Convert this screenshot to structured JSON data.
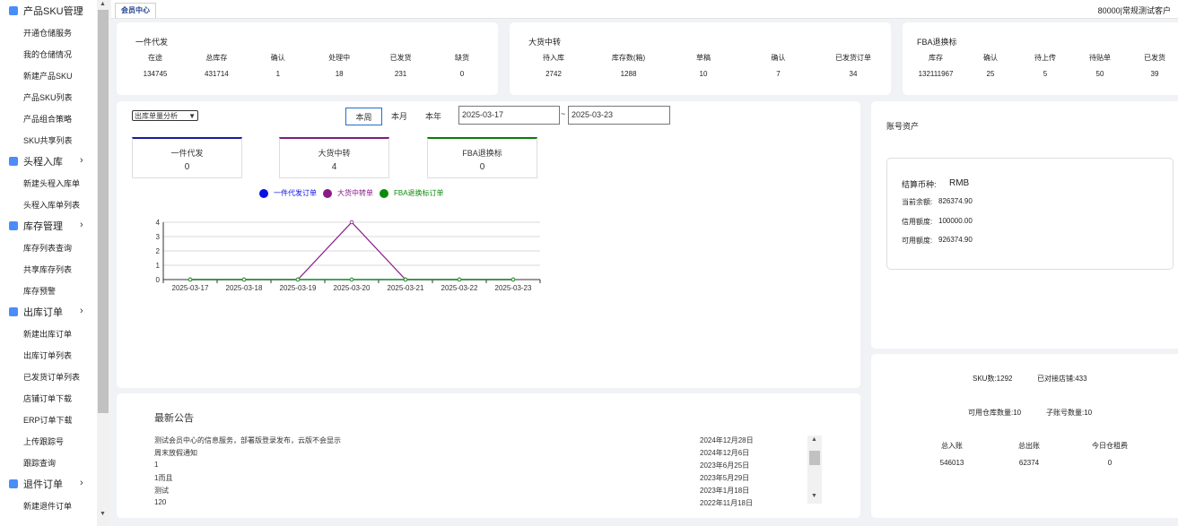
{
  "sidebar": {
    "groups": [
      {
        "label": "产品SKU管理",
        "icon": "grid-icon",
        "items": [
          "开通仓储服务",
          "我的仓储情况",
          "新建产品SKU",
          "产品SKU列表",
          "产品组合策略",
          "SKU共享列表"
        ]
      },
      {
        "label": "头程入库",
        "icon": "inbound-icon",
        "items": [
          "新建头程入库单",
          "头程入库单列表"
        ]
      },
      {
        "label": "库存管理",
        "icon": "warehouse-icon",
        "items": [
          "库存列表查询",
          "共享库存列表",
          "库存预警"
        ]
      },
      {
        "label": "出库订单",
        "icon": "outbound-icon",
        "items": [
          "新建出库订单",
          "出库订单列表",
          "已发货订单列表",
          "店铺订单下载",
          "ERP订单下载",
          "上传跟踪号",
          "跟踪查询"
        ]
      },
      {
        "label": "退件订单",
        "icon": "return-icon",
        "items": [
          "新建退件订单"
        ]
      }
    ]
  },
  "topbar": {
    "tab": "会员中心",
    "account": "80000|常规测试客户"
  },
  "cards": {
    "yijian": {
      "title": "一件代发",
      "stats": [
        {
          "label": "在途",
          "value": "134745"
        },
        {
          "label": "总库存",
          "value": "431714"
        },
        {
          "label": "确认",
          "value": "1"
        },
        {
          "label": "处理中",
          "value": "18"
        },
        {
          "label": "已发货",
          "value": "231"
        },
        {
          "label": "缺货",
          "value": "0"
        }
      ]
    },
    "dahuo": {
      "title": "大货中转",
      "stats": [
        {
          "label": "待入库",
          "value": "2742"
        },
        {
          "label": "库存数(箱)",
          "value": "1288"
        },
        {
          "label": "草稿",
          "value": "10"
        },
        {
          "label": "确认",
          "value": "7"
        },
        {
          "label": "已发货订单",
          "value": "34"
        }
      ]
    },
    "fba": {
      "title": "FBA退换标",
      "stats": [
        {
          "label": "库存",
          "value": "132111967"
        },
        {
          "label": "确认",
          "value": "25"
        },
        {
          "label": "待上传",
          "value": "5"
        },
        {
          "label": "待贴单",
          "value": "50"
        },
        {
          "label": "已发货",
          "value": "39"
        }
      ]
    }
  },
  "analysis": {
    "select": "出库单量分析",
    "periods": [
      "本周",
      "本月",
      "本年"
    ],
    "active_period": "本周",
    "date_from": "2025-03-17",
    "date_sep": "~",
    "date_to": "2025-03-23",
    "boxes": [
      {
        "label": "一件代发",
        "value": "0",
        "color": "#1a1aa0"
      },
      {
        "label": "大货中转",
        "value": "4",
        "color": "#7b1e7b"
      },
      {
        "label": "FBA退换标",
        "value": "0",
        "color": "#0a7a0a"
      }
    ]
  },
  "chart_data": {
    "type": "line",
    "x": [
      "2025-03-17",
      "2025-03-18",
      "2025-03-19",
      "2025-03-20",
      "2025-03-21",
      "2025-03-22",
      "2025-03-23"
    ],
    "ylim": [
      0,
      4
    ],
    "yticks": [
      "0",
      "1",
      "2",
      "3",
      "4"
    ],
    "series": [
      {
        "name": "一件代发订单",
        "color": "#0b10e6",
        "values": [
          0,
          0,
          0,
          0,
          0,
          0,
          0
        ]
      },
      {
        "name": "大货中转单",
        "color": "#8a1a8a",
        "values": [
          0,
          0,
          0,
          4,
          0,
          0,
          0
        ]
      },
      {
        "name": "FBA退换标订单",
        "color": "#0a8a0a",
        "values": [
          0,
          0,
          0,
          0,
          0,
          0,
          0
        ]
      }
    ]
  },
  "notices": {
    "title": "最新公告",
    "items": [
      {
        "text": "测试会员中心的信息服务，部署版登录发布，云版不会显示",
        "date": "2024年12月28日"
      },
      {
        "text": "周末放假通知",
        "date": "2024年12月6日"
      },
      {
        "text": "1",
        "date": "2023年6月25日"
      },
      {
        "text": "1而且",
        "date": "2023年5月29日"
      },
      {
        "text": "测试",
        "date": "2023年1月18日"
      },
      {
        "text": "120",
        "date": "2022年11月18日"
      }
    ]
  },
  "assets": {
    "title": "账号资产",
    "currency_label": "结算币种:",
    "currency": "RMB",
    "rows": [
      {
        "label": "当前余额:",
        "value": "826374.90"
      },
      {
        "label": "信用额度:",
        "value": "100000.00"
      },
      {
        "label": "可用额度:",
        "value": "926374.90"
      }
    ]
  },
  "summary": {
    "sku": "SKU数:1292",
    "shops": "已对接店铺:433",
    "warehouses": "可用仓库数量:10",
    "subaccounts": "子账号数量:10",
    "cols": [
      {
        "label": "总入账",
        "value": "546013"
      },
      {
        "label": "总出账",
        "value": "62374"
      },
      {
        "label": "今日仓租费",
        "value": "0"
      }
    ]
  }
}
